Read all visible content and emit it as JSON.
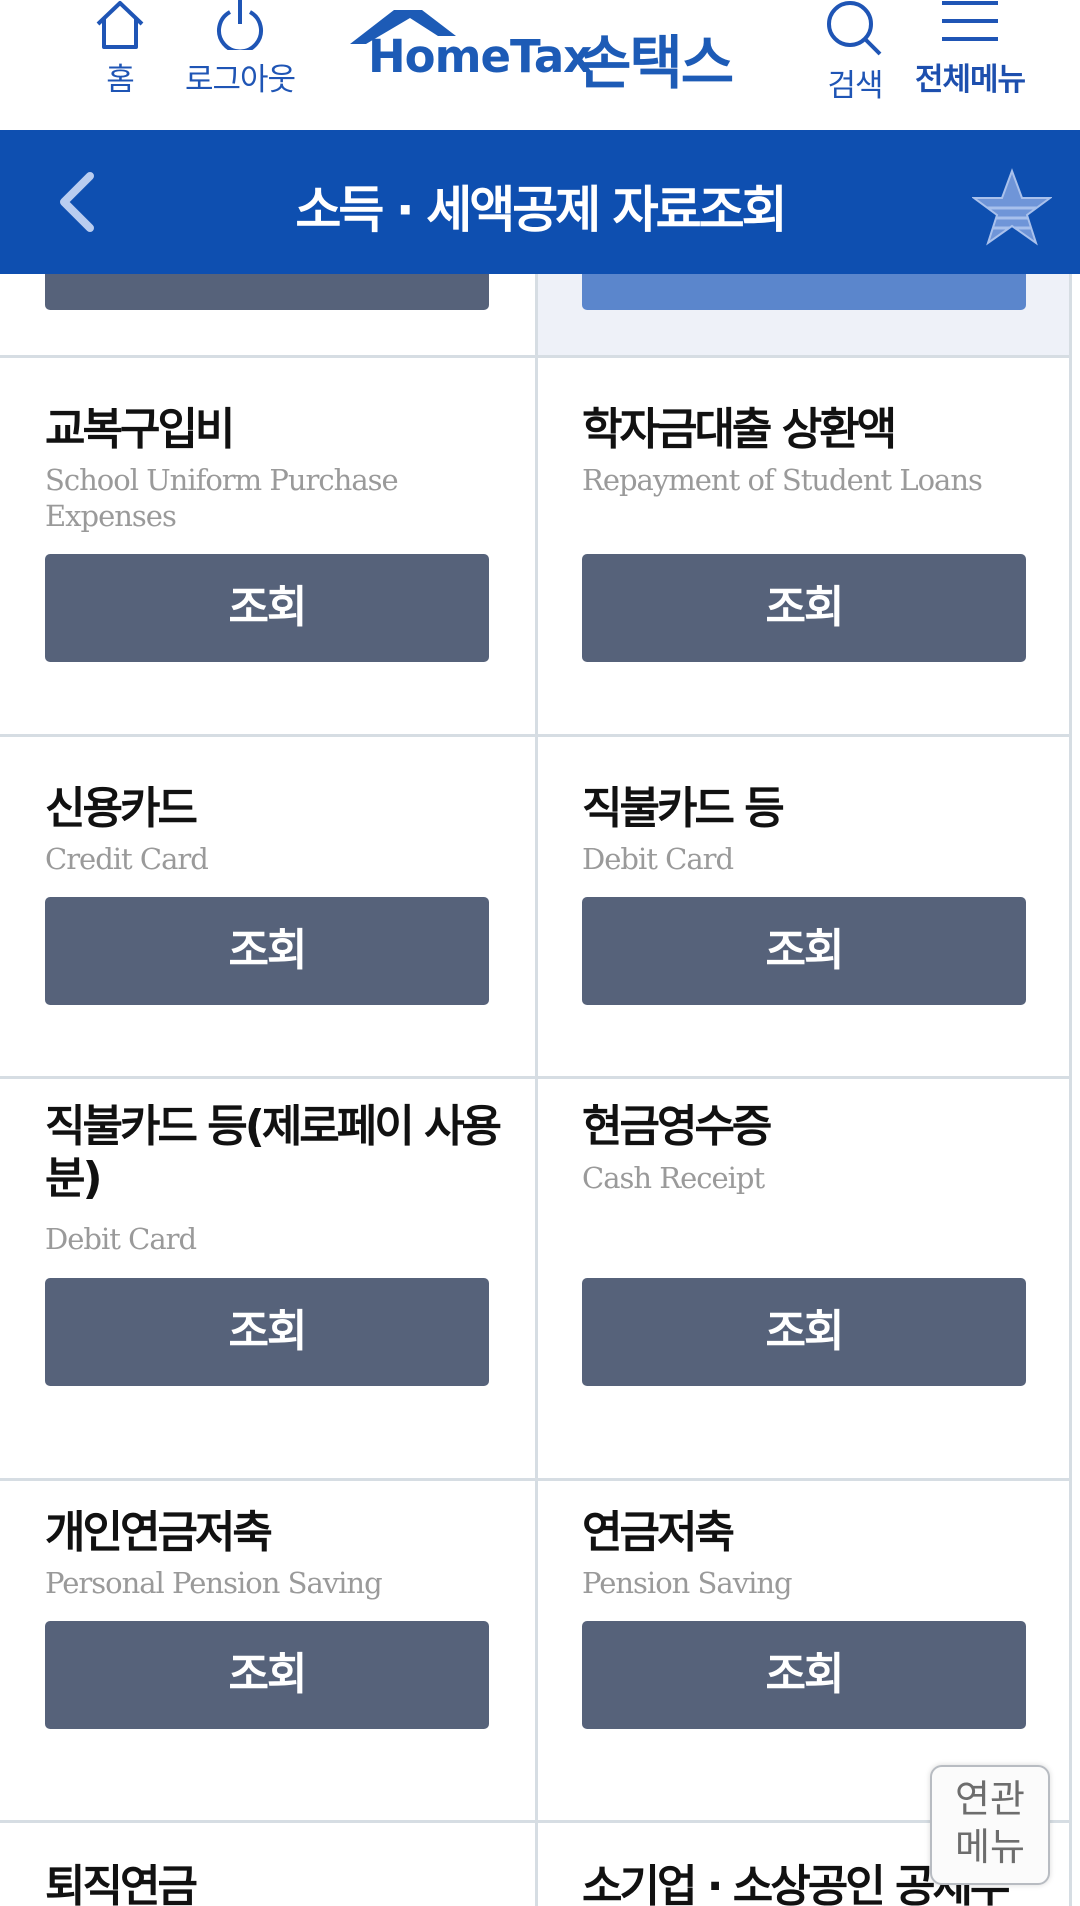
{
  "header": {
    "home_label": "홈",
    "logout_label": "로그아웃",
    "logo_text": "HomeTax",
    "logo_korean": "손택스",
    "search_label": "검색",
    "menu_label": "전체메뉴"
  },
  "titlebar": {
    "title": "소득 · 세액공제 자료조회"
  },
  "items": [
    {
      "title": "교복구입비",
      "subtitle": "School Uniform Purchase Expenses",
      "button": "조회"
    },
    {
      "title": "학자금대출 상환액",
      "subtitle": "Repayment of Student Loans",
      "button": "조회"
    },
    {
      "title": "신용카드",
      "subtitle": "Credit Card",
      "button": "조회"
    },
    {
      "title": "직불카드 등",
      "subtitle": "Debit Card",
      "button": "조회"
    },
    {
      "title": "직불카드 등(제로페이 사용분)",
      "subtitle": "Debit Card",
      "button": "조회"
    },
    {
      "title": "현금영수증",
      "subtitle": "Cash Receipt",
      "button": "조회"
    },
    {
      "title": "개인연금저축",
      "subtitle": "Personal Pension Saving",
      "button": "조회"
    },
    {
      "title": "연금저축",
      "subtitle": "Pension Saving",
      "button": "조회"
    },
    {
      "title": "퇴직연금",
      "subtitle": "",
      "button": ""
    },
    {
      "title": "소기업 · 소상공인 공제부",
      "subtitle": "",
      "button": ""
    }
  ],
  "related_menu": {
    "line1": "연관",
    "line2": "메뉴"
  },
  "colors": {
    "brand_blue": "#0e4fb0",
    "button_gray": "#56627a",
    "button_active_blue": "#5b86cc"
  }
}
